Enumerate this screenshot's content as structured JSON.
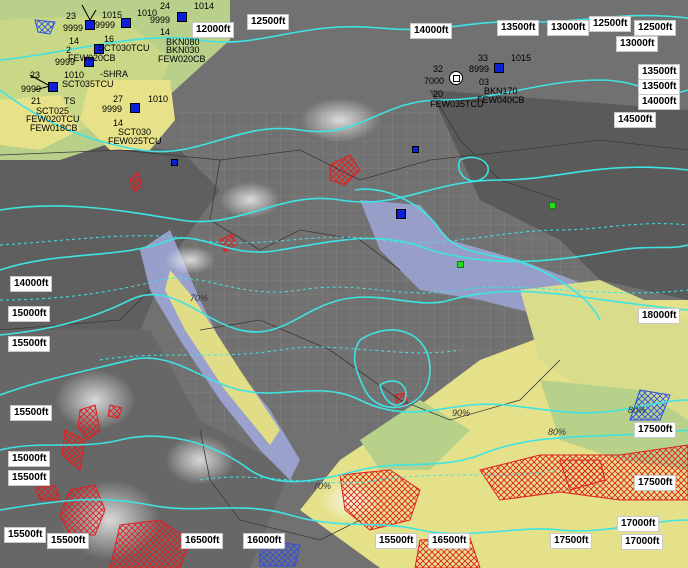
{
  "flight_levels": [
    "12500ft",
    "12000ft",
    "14000ft",
    "13500ft",
    "13000ft",
    "12500ft",
    "12500ft",
    "13000ft",
    "13500ft",
    "13500ft",
    "14000ft",
    "14500ft",
    "14000ft",
    "15000ft",
    "15500ft",
    "18000ft",
    "15500ft",
    "15000ft",
    "15500ft",
    "17500ft",
    "17500ft",
    "15500ft",
    "15500ft",
    "16500ft",
    "16000ft",
    "15500ft",
    "16500ft",
    "17500ft",
    "17000ft",
    "17000ft"
  ],
  "stations": {
    "s1": {
      "a": "23",
      "b": "9999",
      "c": "1015",
      "d": "14",
      "e": "16",
      "f": "SCT030TCU",
      "g": "FEW020CB",
      "h": "2"
    },
    "s2": {
      "a": "1010",
      "b": "9999",
      "c": "24",
      "d": "1014",
      "e": "14",
      "f": "BKN080",
      "g": "BKN030",
      "h": "FEW020CB"
    },
    "s3": {
      "a": "23",
      "b": "9999",
      "c": "1010",
      "d": "21",
      "e": "TS",
      "f": "SCT025",
      "g": "FEW020TCU",
      "h": "FEW018CB",
      "i": "SCT035TCU",
      "j": "-SHRA",
      "k": "9999"
    },
    "s4": {
      "a": "27",
      "b": "9999",
      "c": "1010",
      "d": "14",
      "e": "SCT030",
      "f": "FEW025TCU"
    },
    "s5": {
      "a": "32",
      "b": "7000",
      "c": "20",
      "d": "FEW035TCU",
      "e": "33",
      "f": "1015",
      "g": "8999",
      "h": "03",
      "i": "BKN170",
      "j": "FEW040CB"
    }
  },
  "percent_labels": [
    "70%",
    "90%",
    "80%",
    "70%",
    "80%"
  ],
  "colors": {
    "cyan": "#3fe3e3",
    "hatch": "#e02020",
    "blue_hatch": "#3050e0",
    "yellow": "#e8e48a",
    "green": "#b7d28a",
    "lavender": "#9aa3d8"
  }
}
